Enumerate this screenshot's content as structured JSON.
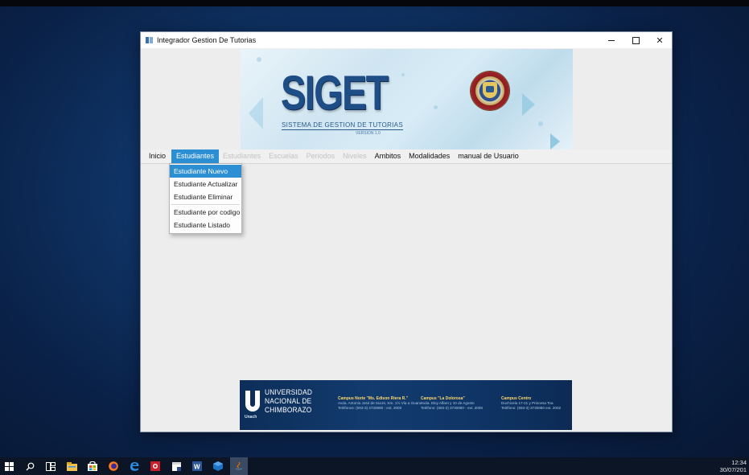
{
  "window": {
    "title": "Integrador Gestion De Tutorias",
    "controls": [
      "minimize",
      "maximize",
      "close"
    ],
    "close_glyph": "✕"
  },
  "banner": {
    "logo_text": "SIGET",
    "subtitle": "SISTEMA DE GESTION DE TUTORIAS",
    "version": "VERSION 1.0",
    "seal_icon": "university-seal-icon"
  },
  "menubar": {
    "items": [
      {
        "label": "Inicio",
        "state": "normal"
      },
      {
        "label": "Estudiantes",
        "state": "active"
      },
      {
        "label": "Estudiantes",
        "state": "disabled"
      },
      {
        "label": "Escuelas",
        "state": "disabled"
      },
      {
        "label": "Periodos",
        "state": "disabled"
      },
      {
        "label": "Niveles",
        "state": "disabled"
      },
      {
        "label": "Ambitos",
        "state": "normal"
      },
      {
        "label": "Modalidades",
        "state": "normal"
      },
      {
        "label": "manual de Usuario",
        "state": "normal"
      }
    ]
  },
  "dropdown": {
    "items": [
      {
        "label": "Estudiante Nuevo",
        "selected": true
      },
      {
        "label": "Estudiante Actualizar",
        "selected": false
      },
      {
        "label": "Estudiante Eliminar",
        "selected": false
      },
      {
        "label": "Estudiante por codigo",
        "selected": false
      },
      {
        "label": "Estudiante Listado",
        "selected": false
      }
    ]
  },
  "footer": {
    "uni_line1": "UNIVERSIDAD",
    "uni_line2": "NACIONAL DE",
    "uni_line3": "CHIMBORAZO",
    "abbr": "Unach",
    "campus": [
      {
        "name": "Campus Norte \"Ms. Edison Riera R.\"",
        "l1": "Avda. Antonio José de Sucre, Km. 1½ Vía a Guano",
        "l2": "Teléfonos: (593-3) 3730880 - ext. 2000"
      },
      {
        "name": "Campus \"La Dolorosa\"",
        "l1": "Avda. Eloy Alfaro y 10 de Agosto",
        "l2": "Teléfono: (593-3) 3730880 - ext. 2008"
      },
      {
        "name": "Campus Centro",
        "l1": "Duchicela 17-21 y Princesa Toa",
        "l2": "Teléfono: (593-3) 3730880 ext. 2002"
      }
    ]
  },
  "taskbar": {
    "icons": [
      "windows-start-icon",
      "search-icon",
      "task-view-icon",
      "file-explorer-icon",
      "store-icon",
      "firefox-icon",
      "edge-icon",
      "app-red-icon",
      "sticky-notes-icon",
      "word-icon",
      "virtualbox-icon",
      "java-app-icon"
    ],
    "time": "12:34",
    "date": "30/07/201"
  },
  "colors": {
    "menu_active": "#2d8fd3",
    "desktop": "#0f3466"
  }
}
